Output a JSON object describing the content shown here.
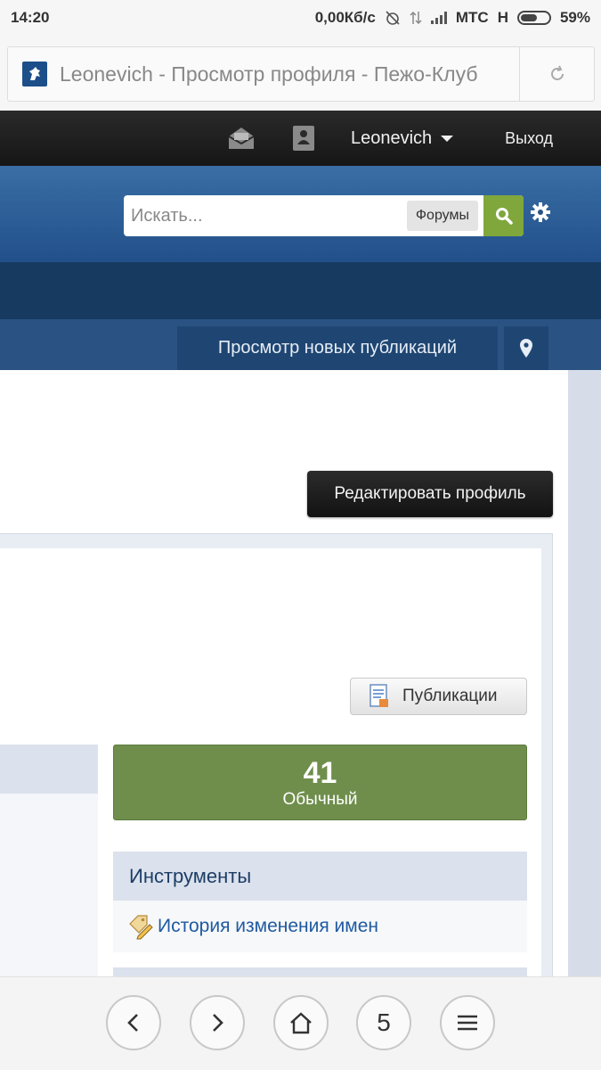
{
  "status_bar": {
    "time": "14:20",
    "network_speed": "0,00Кб/с",
    "carrier": "МТС",
    "network_type": "H",
    "battery": "59%",
    "battery_level": 0.59
  },
  "browser": {
    "url_title": "Leonevich - Просмотр профиля - Пежо-Клуб",
    "favicon": "peugeot-lion-icon",
    "reload_icon": "reload-icon"
  },
  "topbar": {
    "inbox_icon": "envelope-icon",
    "alerts_icon": "alert-person-icon",
    "username": "Leonevich",
    "logout_label": "Выход"
  },
  "search": {
    "placeholder": "Искать...",
    "scope_label": "Форумы",
    "search_icon": "search-icon",
    "settings_icon": "gear-icon"
  },
  "subnav": {
    "new_posts_label": "Просмотр новых публикаций",
    "location_icon": "map-pin-icon"
  },
  "profile": {
    "edit_button_label": "Редактировать профиль",
    "posts_button_label": "Публикации",
    "reputation_value": "41",
    "reputation_label": "Обычный"
  },
  "tools": {
    "heading": "Инструменты",
    "items": [
      {
        "label": "История изменения имен",
        "icon": "tag-pencil-icon"
      }
    ]
  },
  "bottom_nav": {
    "back_icon": "chevron-left-icon",
    "forward_icon": "chevron-right-icon",
    "home_icon": "home-icon",
    "tab_count": "5",
    "menu_icon": "menu-icon"
  },
  "colors": {
    "header_blue": "#2f609a",
    "nav_dark": "#163a60",
    "search_green": "#7fa73c",
    "reputation_green": "#6f8e4c",
    "link_blue": "#1f5aa0"
  }
}
